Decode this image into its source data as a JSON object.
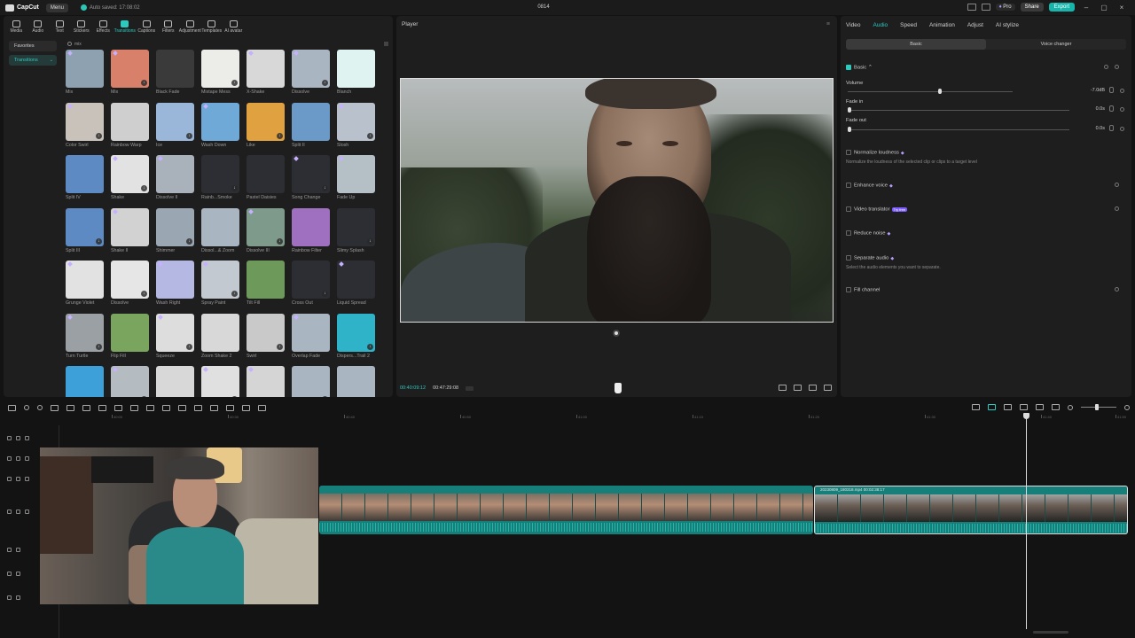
{
  "titlebar": {
    "app_name": "CapCut",
    "menu_label": "Menu",
    "autosave": "Auto saved: 17:08:02",
    "project_title": "0814",
    "pro_label": "Pro",
    "share_label": "Share",
    "export_label": "Export",
    "win_controls": [
      "–",
      "▢",
      "×"
    ]
  },
  "media_panel": {
    "tabs": [
      {
        "label": "Media",
        "icon": "media-icon"
      },
      {
        "label": "Audio",
        "icon": "audio-icon"
      },
      {
        "label": "Text",
        "icon": "text-icon"
      },
      {
        "label": "Stickers",
        "icon": "stickers-icon"
      },
      {
        "label": "Effects",
        "icon": "effects-icon"
      },
      {
        "label": "Transitions",
        "icon": "transitions-icon",
        "active": true
      },
      {
        "label": "Captions",
        "icon": "captions-icon"
      },
      {
        "label": "Filters",
        "icon": "filters-icon"
      },
      {
        "label": "Adjustment",
        "icon": "adjustment-icon"
      },
      {
        "label": "Templates",
        "icon": "templates-icon"
      },
      {
        "label": "AI avatar",
        "icon": "ai-avatar-icon"
      }
    ],
    "categories": {
      "favorites": "Favorites",
      "transitions": "Transitions"
    },
    "search_value": "mix",
    "transitions": [
      "Mix",
      "Mix",
      "Black Fade",
      "Mixtape Mess",
      "X-Shake",
      "Dissolve",
      "Blanch",
      "Color Swirl",
      "Rainbow Warp",
      "Ice",
      "Wash Down",
      "Like",
      "Split II",
      "Slosh",
      "Split IV",
      "Shake",
      "Dissolve II",
      "Rainb...Smoke",
      "Pastel Daisies",
      "Song Change",
      "Fade Up",
      "Split III",
      "Shake II",
      "Shimmer",
      "Dissol...& Zoom",
      "Dissolve III",
      "Rainbow Filter",
      "Slimy Splash",
      "Grunge Violet",
      "Dissolve",
      "Wash Right",
      "Spray Paint",
      "Tilt Fill",
      "Cross Out",
      "Liquid Spread",
      "Turn Turtle",
      "Flip Fill",
      "Squeeze",
      "Zoom Shake 2",
      "Swirl",
      "Overlap Fade",
      "Dispers...Trail 2",
      "",
      "",
      "",
      "",
      "",
      "",
      ""
    ],
    "thumb_colors": [
      "#8ea1b0",
      "#d8806a",
      "#3a3a3a",
      "#ecece8",
      "#d8d8d8",
      "#a9b6c2",
      "#dff4f1",
      "#c9c2bb",
      "#cfcfcf",
      "#9ab6d8",
      "#6fa9d8",
      "#e0a140",
      "#6b9ac8",
      "#b9c2cc",
      "#5d8ac2",
      "#e2e2e2",
      "#a9b2ba",
      "#2c2e33",
      "#2c2e33",
      "#2c2e33",
      "#b4bfc6",
      "#5d8ac2",
      "#d2d2d2",
      "#9aa6b2",
      "#a9b6c2",
      "#7d9a8a",
      "#a070c0",
      "#2c2e33",
      "#e2e2e2",
      "#e6e6e6",
      "#b5b8e2",
      "#c3c9d1",
      "#6d9a5a",
      "#2c2e33",
      "#2c2e33",
      "#9aa0a4",
      "#79a55f",
      "#ddd",
      "#d8d8d8",
      "#c9c9c9",
      "#a9b6c2",
      "#2eb3c9",
      "#3ea0d8",
      "#b4bcc2",
      "#d8d8d8",
      "#e0e0e0",
      "#d5d5d5",
      "#a9b6c2",
      "#a9b6c2"
    ]
  },
  "player": {
    "title": "Player",
    "current_time": "00:40:09:12",
    "total_time": "00:47:29:08"
  },
  "details": {
    "tabs": [
      "Video",
      "Audio",
      "Speed",
      "Animation",
      "Adjust",
      "AI stylize"
    ],
    "active_tab": "Audio",
    "subtabs": [
      "Basic",
      "Voice changer"
    ],
    "basic_label": "Basic",
    "volume_label": "Volume",
    "volume_value": "-7.0dB",
    "volume_level": 0.55,
    "fade_in_label": "Fade in",
    "fade_in_value": "0.0s",
    "fade_out_label": "Fade out",
    "fade_out_value": "0.0s",
    "normalize_label": "Normalize loudness",
    "normalize_desc": "Normalize the loudness of the selected clip or clips to a target level",
    "enhance_label": "Enhance voice",
    "translator_label": "Video translator",
    "translator_badge": "Try free",
    "reduce_noise_label": "Reduce noise",
    "separate_label": "Separate audio",
    "separate_desc": "Select the audio elements you want to separate.",
    "fill_channel_label": "Fill channel"
  },
  "timeline": {
    "ruler_ticks": [
      "40:00",
      "40:30",
      "40:40",
      "40:50",
      "41:00",
      "41:10",
      "41:20",
      "41:30",
      "41:40",
      "41:50"
    ],
    "clip2_label": "20230809_180318.mp4  00:02:38:17"
  }
}
